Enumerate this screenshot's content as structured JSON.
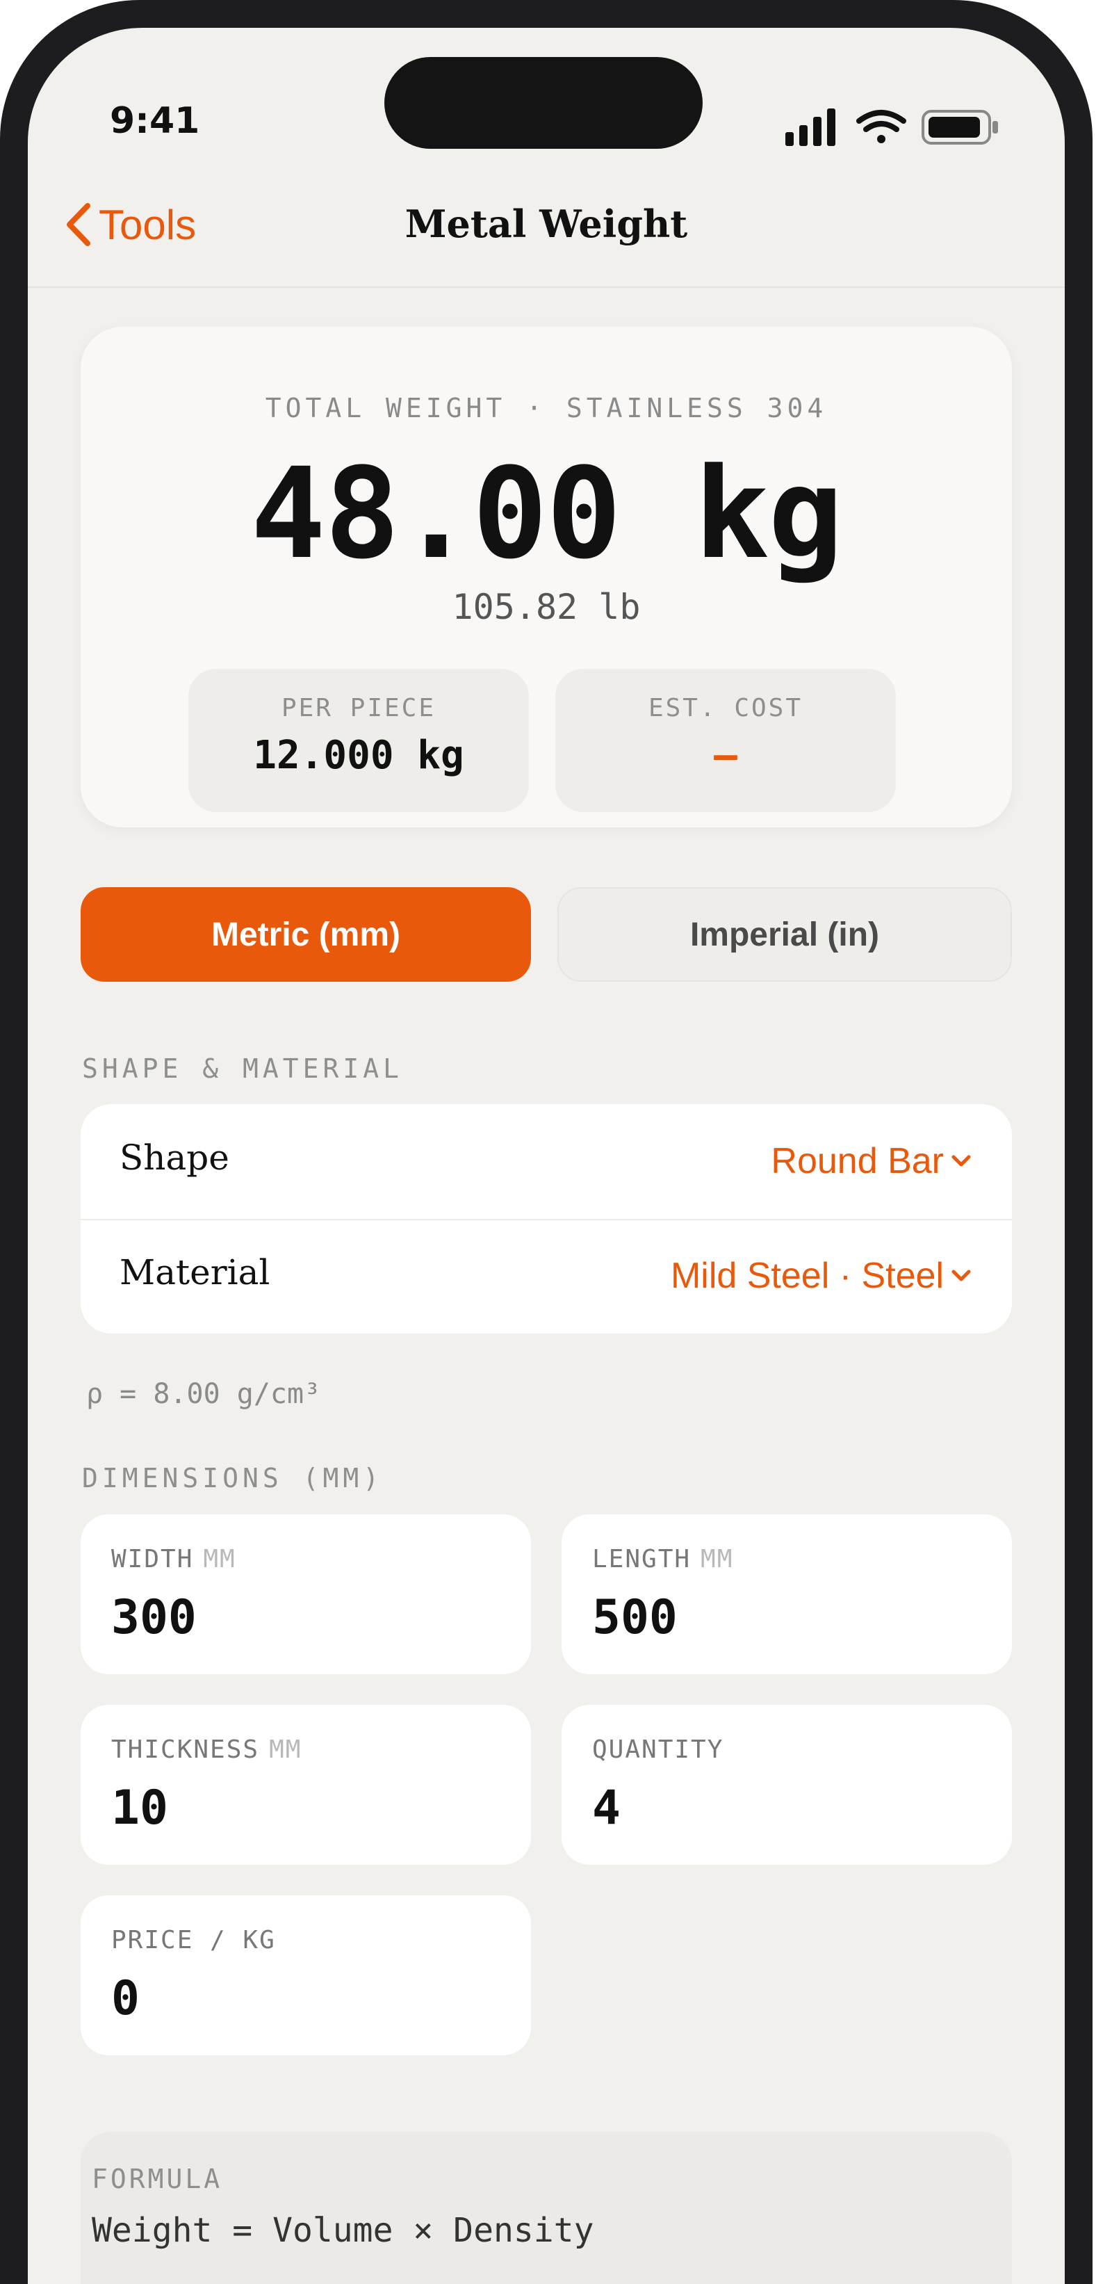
{
  "status_bar": {
    "time": "9:41"
  },
  "nav": {
    "back_label": "Tools",
    "title": "Metal Weight"
  },
  "summary": {
    "label": "TOTAL WEIGHT · STAINLESS 304",
    "total_weight": "48.00 kg",
    "total_weight_alt": "105.82 lb",
    "per_piece_label": "PER PIECE",
    "per_piece_value": "12.000 kg",
    "est_cost_label": "EST. COST",
    "est_cost_value": "—"
  },
  "units_toggle": {
    "metric_label": "Metric (mm)",
    "imperial_label": "Imperial (in)",
    "selected": "Metric (mm)"
  },
  "shape_material": {
    "section_label": "SHAPE & MATERIAL",
    "shape_label": "Shape",
    "shape_value": "Round Bar",
    "material_label": "Material",
    "material_value": "Mild Steel · Steel",
    "density_text": "ρ = 8.00 g/cm³"
  },
  "dimensions": {
    "section_label": "DIMENSIONS (MM)",
    "width": {
      "label": "WIDTH",
      "unit": "MM",
      "value": "300"
    },
    "length": {
      "label": "LENGTH",
      "unit": "MM",
      "value": "500"
    },
    "thickness": {
      "label": "THICKNESS",
      "unit": "MM",
      "value": "10"
    },
    "quantity": {
      "label": "QUANTITY",
      "value": "4"
    },
    "price": {
      "label": "PRICE / KG",
      "value": "0"
    }
  },
  "formula": {
    "label": "FORMULA",
    "text": "Weight = Volume × Density"
  },
  "colors": {
    "accent": "#e8590c",
    "background": "#f1f0ed",
    "card": "#ffffff",
    "text": "#111111"
  },
  "icons": [
    "chevron-left-icon",
    "chevron-down-icon",
    "signal-icon",
    "wifi-icon",
    "battery-icon"
  ]
}
